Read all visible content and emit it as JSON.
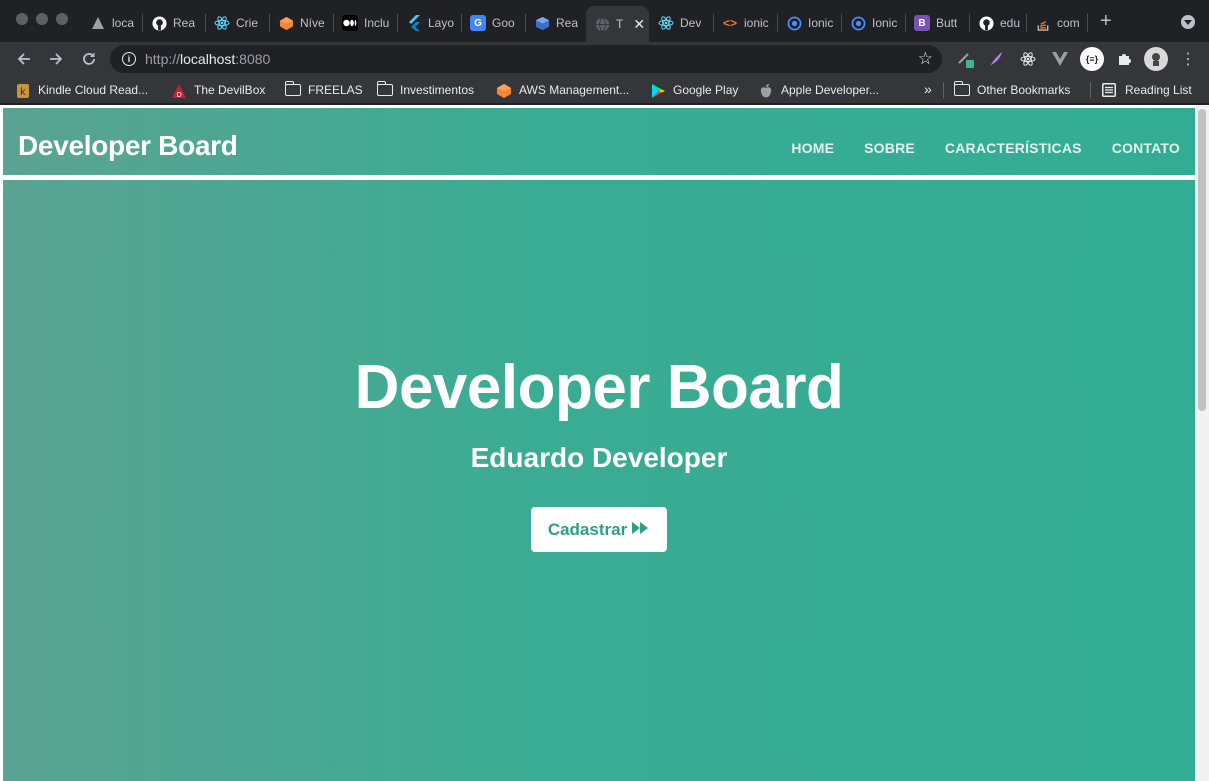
{
  "browser": {
    "tabs": [
      {
        "title": "loca",
        "icon": "triangle-icon",
        "color": "#5f6368"
      },
      {
        "title": "Rea",
        "icon": "github-icon",
        "color": "#ffffff"
      },
      {
        "title": "Crie",
        "icon": "react-icon",
        "color": "#61dafb"
      },
      {
        "title": "Níve",
        "icon": "aws-icon",
        "color": "#f58536"
      },
      {
        "title": "Inclu",
        "icon": "medium-icon",
        "color": "#ffffff"
      },
      {
        "title": "Layo",
        "icon": "flutter-icon",
        "color": "#4fc3f7"
      },
      {
        "title": "Goo",
        "icon": "google-translate-icon",
        "color": "#4285f4"
      },
      {
        "title": "Rea",
        "icon": "cube-icon",
        "color": "#4f8ee8"
      },
      {
        "title": "T",
        "icon": "globe-icon",
        "color": "#9aa0a6",
        "active": true
      },
      {
        "title": "Dev",
        "icon": "react-icon",
        "color": "#61dafb"
      },
      {
        "title": "ionic",
        "icon": "code-icon",
        "color": "#f0733a"
      },
      {
        "title": "Ionic",
        "icon": "ionic-icon",
        "color": "#4c8dff"
      },
      {
        "title": "Ionic",
        "icon": "ionic-icon",
        "color": "#4c8dff"
      },
      {
        "title": "Butt",
        "icon": "bootstrap-icon",
        "color": "#7952b3"
      },
      {
        "title": "edu",
        "icon": "github-icon",
        "color": "#ffffff"
      },
      {
        "title": "com",
        "icon": "stackoverflow-icon",
        "color": "#f48024"
      }
    ],
    "url": {
      "scheme": "http://",
      "host": "localhost",
      "port": ":8080"
    },
    "bookmarks": [
      {
        "label": "Kindle Cloud Read...",
        "icon": "kindle-icon"
      },
      {
        "label": "The DevilBox",
        "icon": "devilbox-icon"
      },
      {
        "label": "FREELAS",
        "icon": "folder-icon"
      },
      {
        "label": "Investimentos",
        "icon": "folder-icon"
      },
      {
        "label": "AWS Management...",
        "icon": "aws-icon"
      },
      {
        "label": "Google Play",
        "icon": "google-play-icon"
      },
      {
        "label": "Apple Developer...",
        "icon": "apple-icon"
      }
    ],
    "bookmarks_overflow": "»",
    "other_bookmarks": "Other Bookmarks",
    "reading_list": "Reading List"
  },
  "site": {
    "brand": "Developer Board",
    "menu": [
      "HOME",
      "SOBRE",
      "CARACTERÍSTICAS",
      "CONTATO"
    ],
    "hero_title": "Developer Board",
    "hero_subtitle": "Eduardo Developer",
    "cta_label": "Cadastrar",
    "cta_icon": "fast-forward-icon"
  }
}
